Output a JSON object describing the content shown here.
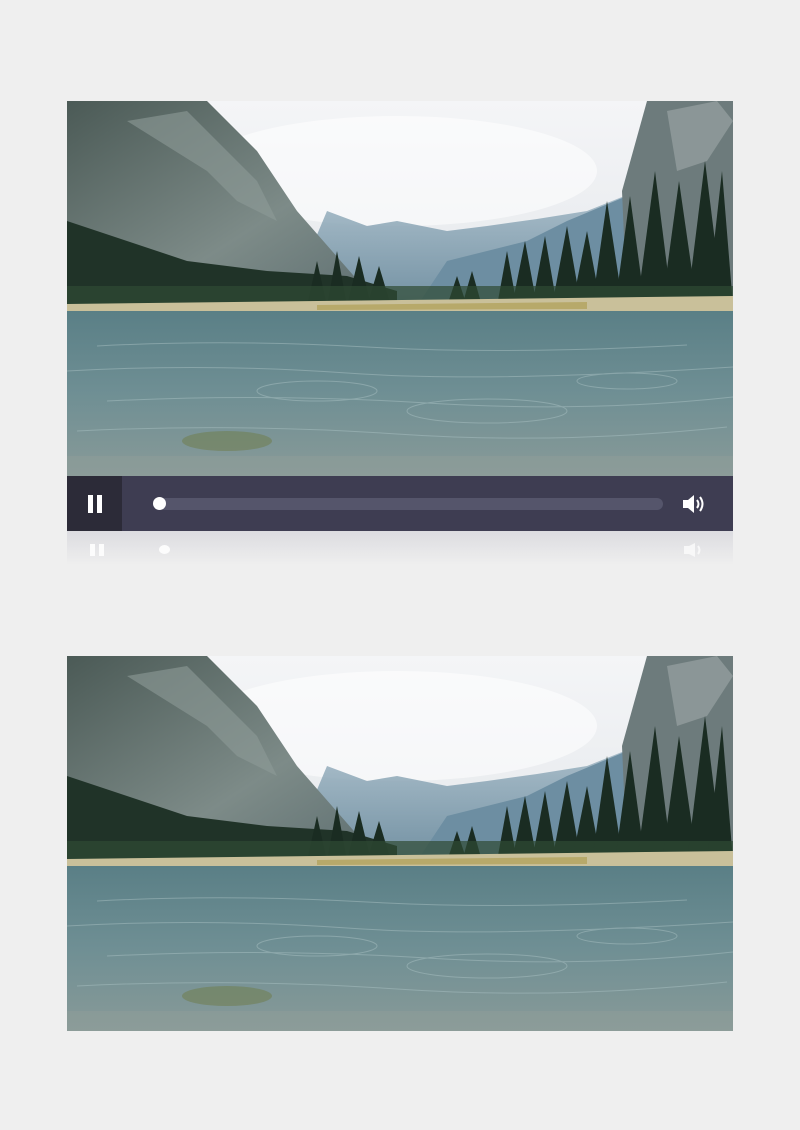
{
  "player": {
    "state": "playing",
    "progress": 0.0,
    "controls": {
      "pause_icon": "pause-icon",
      "volume_icon": "volume-icon"
    }
  },
  "scene": "mountain-lake-landscape",
  "colors": {
    "page_background": "#efefef",
    "control_bar": "#3e3d52",
    "pause_button_bg": "#2c2b38",
    "track": "#55556b",
    "knob": "#ffffff"
  }
}
